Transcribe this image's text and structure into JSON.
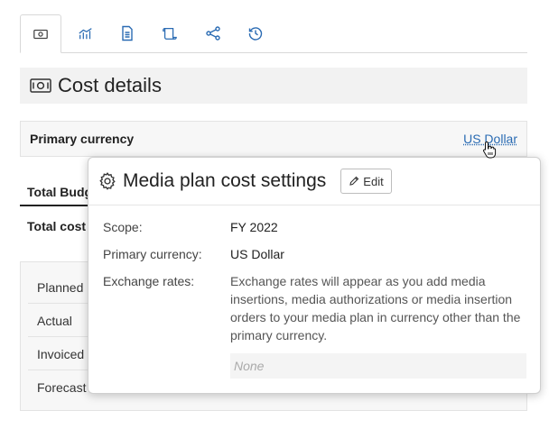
{
  "tabs": [
    {
      "icon": "money-icon"
    },
    {
      "icon": "bar-chart-icon"
    },
    {
      "icon": "document-icon"
    },
    {
      "icon": "scroll-icon"
    },
    {
      "icon": "share-icon"
    },
    {
      "icon": "history-icon"
    }
  ],
  "section": {
    "title": "Cost details"
  },
  "currency": {
    "label": "Primary currency",
    "value": "US Dollar"
  },
  "budget": {
    "tab_label": "Total Budg",
    "total_label": "Total cost"
  },
  "status_items": [
    "Planned",
    "Actual",
    "Invoiced",
    "Forecast"
  ],
  "popover": {
    "title": "Media plan cost settings",
    "edit_label": "Edit",
    "scope_label": "Scope:",
    "scope_value": "FY 2022",
    "currency_label": "Primary currency:",
    "currency_value": "US Dollar",
    "rates_label": "Exchange rates:",
    "rates_description": "Exchange rates will appear as you add media insertions, media authorizations or media insertion orders to your media plan in currency other than the primary currency.",
    "rates_empty": "None"
  },
  "colors": {
    "link": "#2a6bb3",
    "panel": "#f2f2f2"
  }
}
